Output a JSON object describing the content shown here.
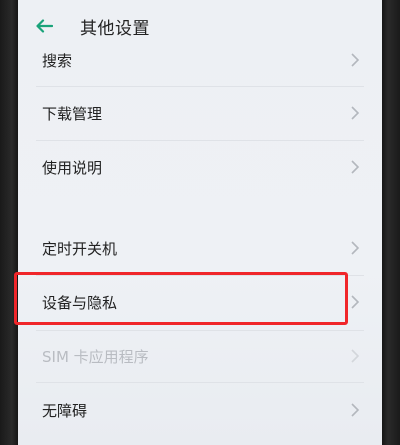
{
  "header": {
    "title": "其他设置",
    "back_icon": "back-arrow-icon",
    "accent": "#1aa37a"
  },
  "settings": [
    {
      "label": "搜索"
    },
    {
      "label": "下载管理"
    },
    {
      "label": "使用说明"
    },
    {
      "label": "定时开关机"
    },
    {
      "label": "设备与隐私"
    },
    {
      "label": "SIM 卡应用程序"
    },
    {
      "label": "无障碍"
    }
  ],
  "highlight_color": "#f0262a"
}
